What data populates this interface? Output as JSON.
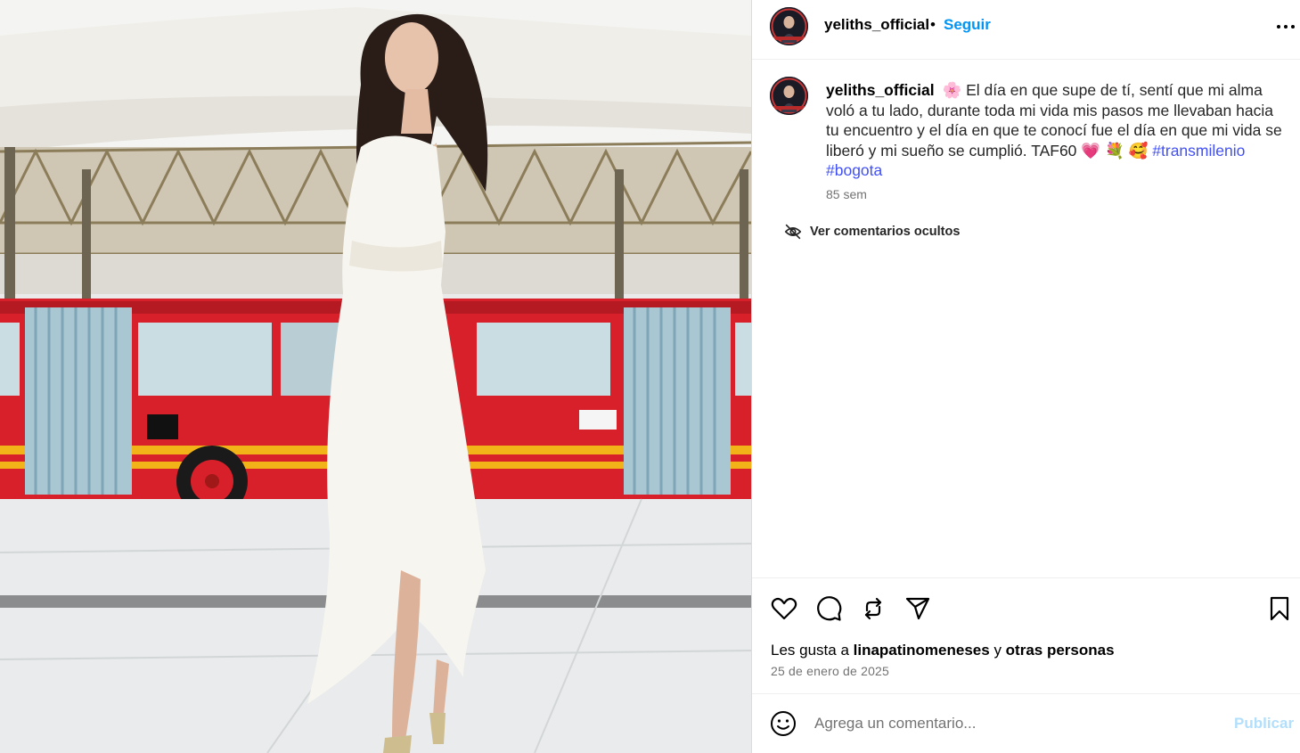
{
  "post": {
    "image_alt": "Mujer con vestido blanco frente a un bus articulado rojo de TransMilenio"
  },
  "header": {
    "username": "yeliths_official",
    "separator": "•",
    "follow_label": "Seguir",
    "more_icon": "more-horizontal-icon"
  },
  "caption": {
    "username": "yeliths_official",
    "emoji_start": "🌸",
    "text": "El día en que supe de tí, sentí que mi alma voló a tu lado, durante toda mi vida mis pasos me llevaban hacia tu encuentro y el día en que te conocí fue el día en que mi vida se liberó y mi sueño se cumplió. TAF60",
    "emojis_end": "💗 💐 🥰",
    "hashtags": [
      "#transmilenio",
      "#bogota"
    ],
    "time": "85 sem"
  },
  "comments": {
    "hidden_label": "Ver comentarios ocultos",
    "hidden_icon": "eye-off-icon"
  },
  "actions": {
    "icons": [
      "heart-icon",
      "comment-icon",
      "repost-icon",
      "share-icon",
      "bookmark-icon"
    ],
    "likes_prefix": "Les gusta a",
    "likes_user": "linapatinomeneses",
    "likes_connector": "y",
    "likes_suffix": "otras personas",
    "date": "25 de enero de 2025"
  },
  "comment_box": {
    "placeholder": "Agrega un comentario...",
    "publish_label": "Publicar",
    "emoji_icon": "smiley-icon"
  },
  "colors": {
    "link": "#0095f6",
    "hashtag": "#4150f7",
    "muted": "#737373",
    "publish_disabled": "#b2dffc",
    "bus_red": "#d7202a"
  }
}
